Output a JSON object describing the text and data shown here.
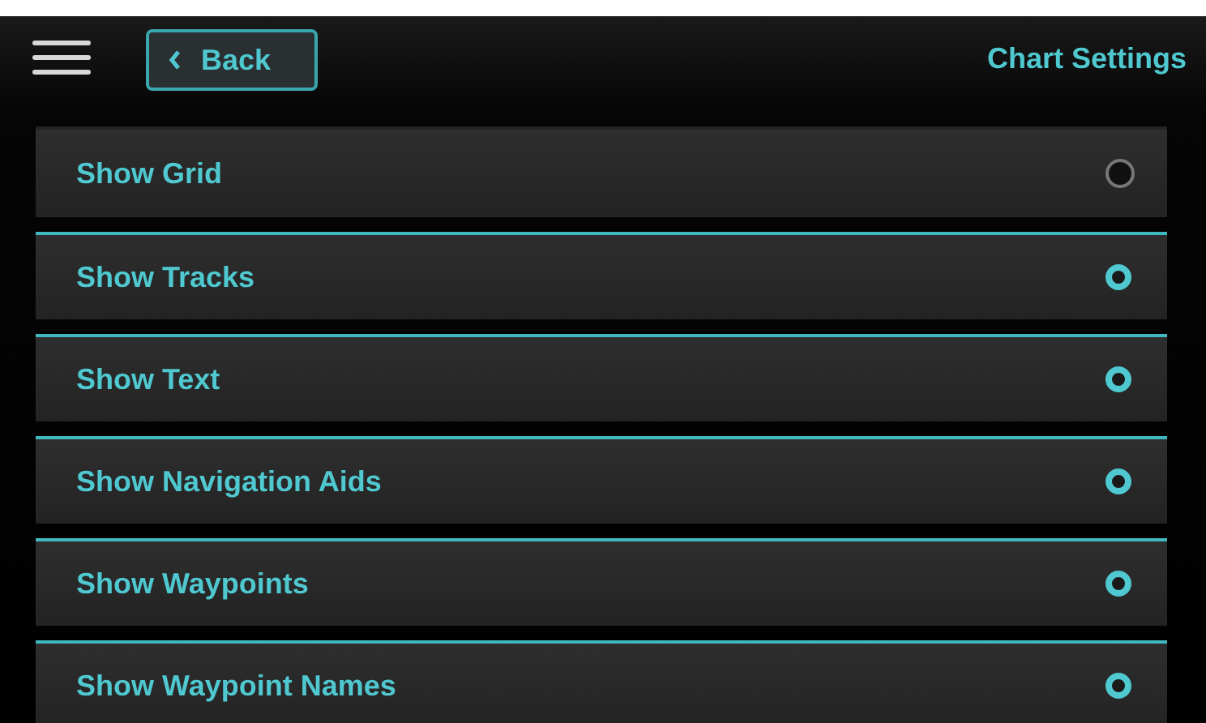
{
  "header": {
    "back_button": {
      "label": "Back"
    },
    "title": "Chart Settings"
  },
  "settings": [
    {
      "label": "Show Grid",
      "on": false
    },
    {
      "label": "Show Tracks",
      "on": true
    },
    {
      "label": "Show Text",
      "on": true
    },
    {
      "label": "Show Navigation Aids",
      "on": true
    },
    {
      "label": "Show Waypoints",
      "on": true
    },
    {
      "label": "Show Waypoint Names",
      "on": true
    }
  ]
}
